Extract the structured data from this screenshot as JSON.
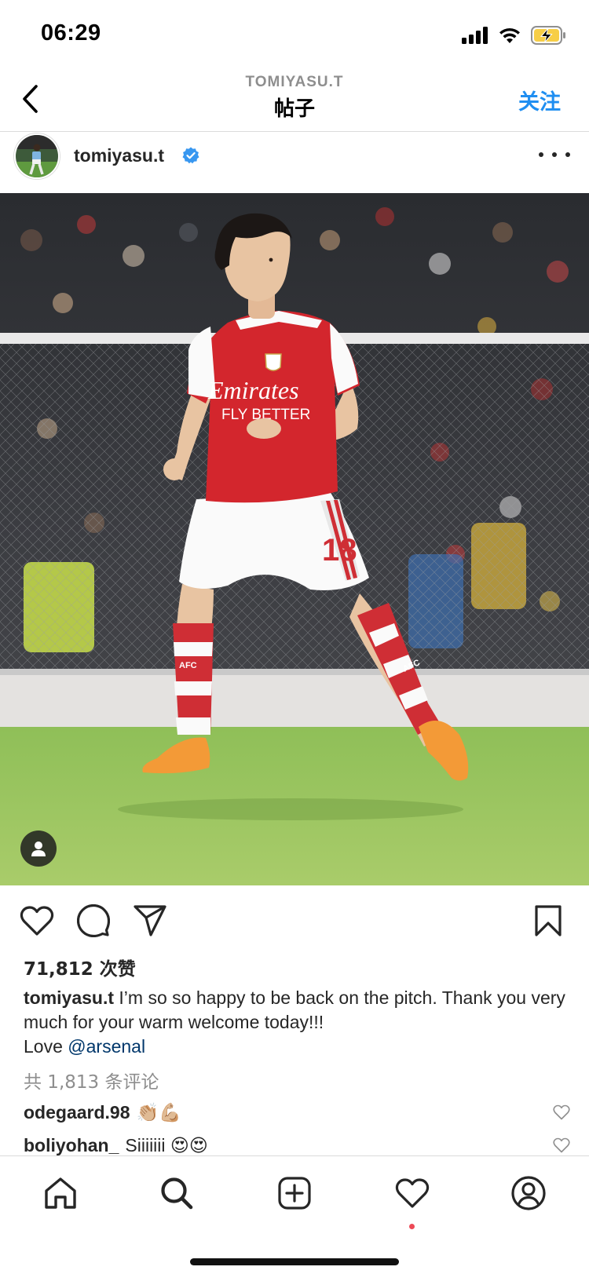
{
  "status_bar": {
    "time": "06:29",
    "icons": [
      "cellular-signal-icon",
      "wifi-icon",
      "battery-charging-icon"
    ],
    "battery_color": "#f7ce46"
  },
  "header": {
    "username": "TOMIYASU.T",
    "title": "帖子",
    "follow_label": "关注",
    "back_icon": "chevron-left-icon"
  },
  "post": {
    "author": "tomiyasu.t",
    "verified": true,
    "more_icon": "more-horizontal-icon",
    "photo": {
      "shirt_sponsor": "Emirates",
      "shirt_tagline": "FLY BETTER",
      "shorts_number": "18",
      "sock_text": "AFC"
    },
    "tag_icon": "user-tag-icon",
    "actions": [
      "heart-icon",
      "comment-icon",
      "share-icon",
      "bookmark-icon"
    ],
    "likes": "71,812 次赞",
    "caption": {
      "user": "tomiyasu.t",
      "text": " I’m so so happy to be back on the pitch. Thank you very much for your warm welcome today!!!",
      "love": "Love ",
      "mention": "@arsenal"
    },
    "view_comments": "共 1,813 条评论",
    "comments": [
      {
        "user": "odegaard.98",
        "text": "👏🏼💪🏼"
      },
      {
        "user": "boliyohan_",
        "text": "Siiiiiii 😍😍"
      }
    ]
  },
  "bottom_nav": {
    "items": [
      "home-icon",
      "search-icon",
      "new-post-icon",
      "activity-heart-icon",
      "profile-icon"
    ],
    "activity_dot_color": "#ed4956"
  },
  "colors": {
    "accent": "#1f8ef1",
    "mention": "#00376b",
    "arsenal_red": "#d3262d",
    "pitch_green": "#8cba55"
  }
}
